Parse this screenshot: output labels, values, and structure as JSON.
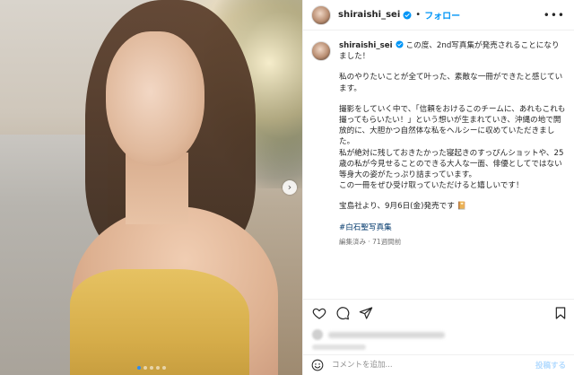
{
  "post": {
    "username": "shiraishi_sei",
    "follow_separator": "•",
    "follow_label": "フォロー",
    "more_icon": "more-horizontal-icon"
  },
  "caption": {
    "username": "shiraishi_sei",
    "line1": "この度、2nd写真集が発売されることになりました！",
    "para1": "私のやりたいことが全て叶った、素敵な一冊ができたと感じています。",
    "para2_lines": [
      "撮影をしていく中で、「信頼をおけるこのチームに、あれもこれも撮ってもらいたい！」という想いが生まれていき、沖縄の地で開放的に、大胆かつ自然体な私をヘルシーに収めていただきました。",
      "私が絶対に残しておきたかった寝起きのすっぴんショットや、25歳の私が今見せることのできる大人な一面、俳優としてではない等身大の姿がたっぷり詰まっています。",
      "この一冊をぜひ受け取っていただけると嬉しいです！"
    ],
    "para3": "宝島社より、9月6日(金)発売です",
    "hashtag": "#白石聖写真集",
    "meta": "編集済み · 71週間前"
  },
  "carousel": {
    "total_slides": 5,
    "active_index": 0
  },
  "comment": {
    "placeholder": "コメントを追加...",
    "post_label": "投稿する"
  },
  "colors": {
    "link_blue": "#0095f6",
    "hashtag": "#00376b",
    "verified": "#0095f6",
    "post_disabled": "#b3dbff"
  }
}
